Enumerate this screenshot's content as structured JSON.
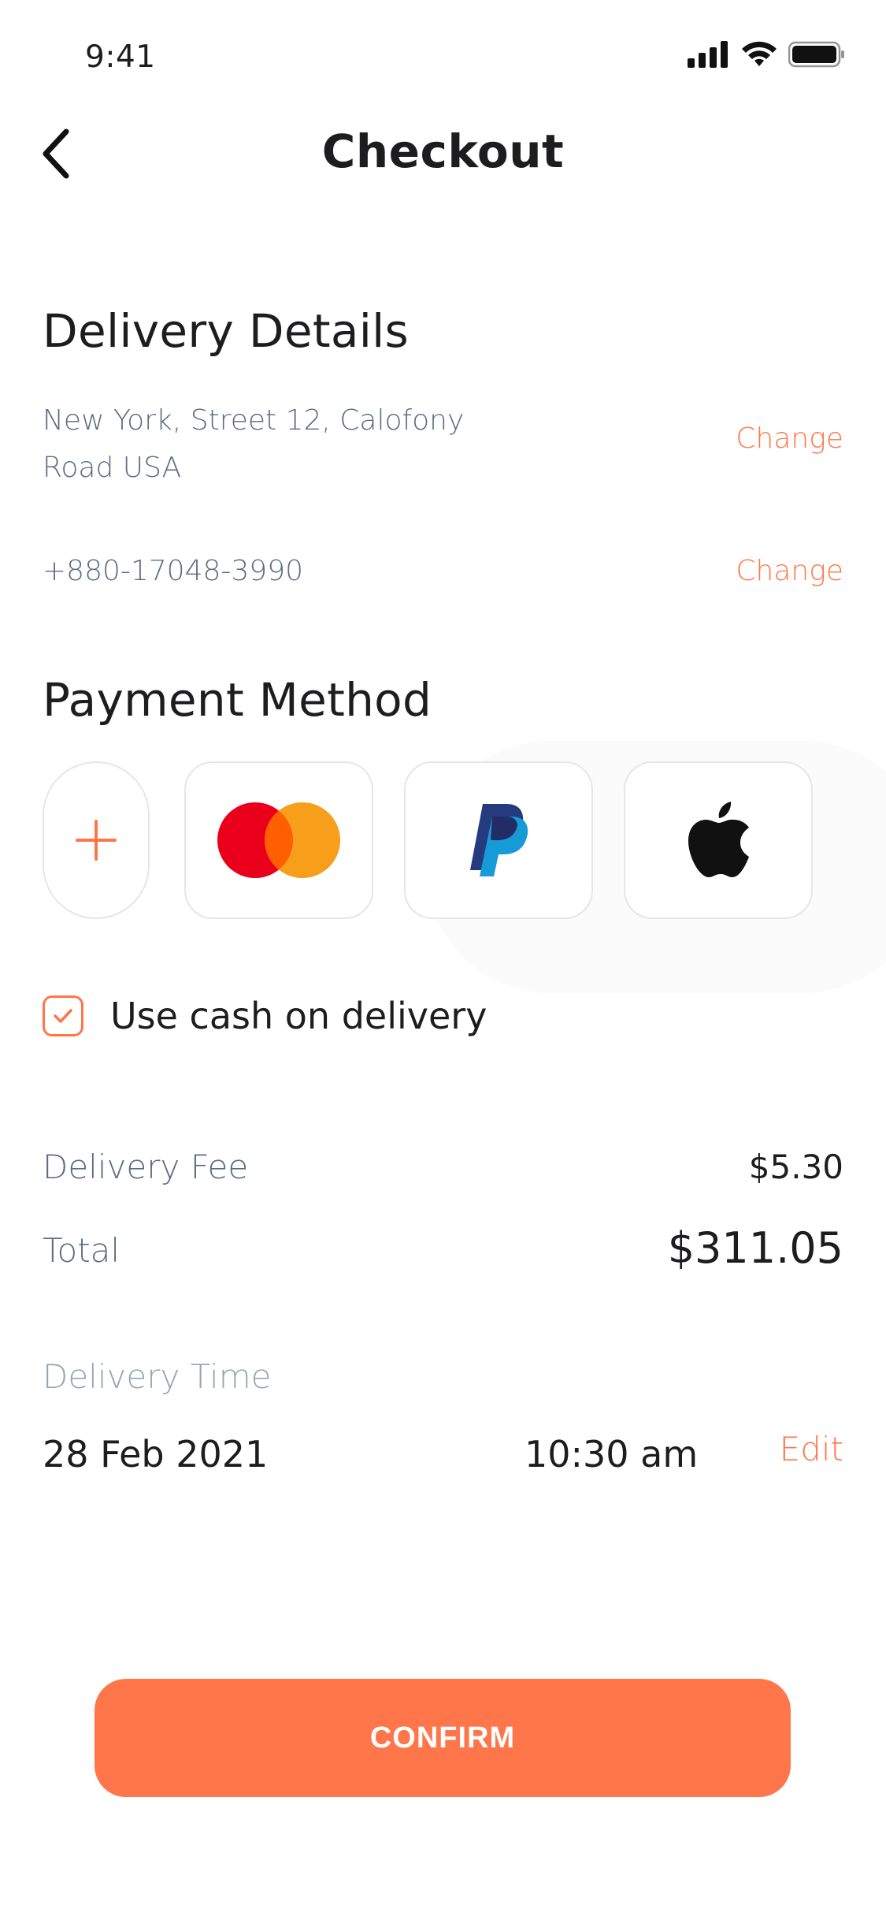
{
  "status_bar": {
    "time": "9:41"
  },
  "header": {
    "title": "Checkout"
  },
  "delivery": {
    "title": "Delivery Details",
    "address": "New York, Street 12, Calofony Road USA",
    "address_change": "Change",
    "phone": "+880-17048-3990",
    "phone_change": "Change"
  },
  "payment": {
    "title": "Payment Method",
    "methods": [
      {
        "icon": "plus-icon"
      },
      {
        "icon": "mastercard-icon"
      },
      {
        "icon": "paypal-icon"
      },
      {
        "icon": "apple-pay-icon"
      }
    ],
    "cash_on_delivery": {
      "label": "Use cash on delivery",
      "checked": true
    }
  },
  "summary": {
    "fee_label": "Delivery Fee",
    "fee_value": "$5.30",
    "total_label": "Total",
    "total_value": "$311.05"
  },
  "delivery_time": {
    "label": "Delivery Time",
    "date": "28 Feb 2021",
    "time": "10:30 am",
    "edit": "Edit"
  },
  "actions": {
    "confirm": "CONFIRM"
  },
  "colors": {
    "accent": "#ff764a",
    "muted": "#5e6b80",
    "text": "#1d1d1f"
  }
}
